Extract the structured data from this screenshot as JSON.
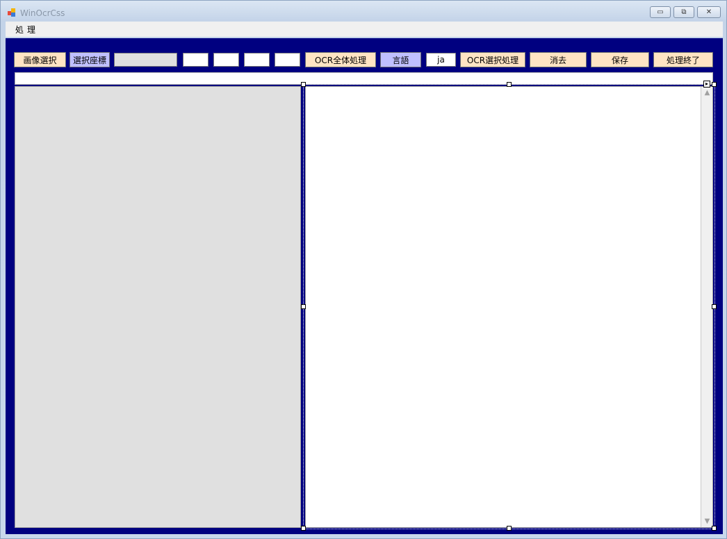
{
  "window": {
    "title": "WinOcrCss",
    "minimize_glyph": "▭",
    "maximize_glyph": "⧉",
    "close_glyph": "✕"
  },
  "menu": {
    "items": [
      {
        "label": "処理"
      }
    ]
  },
  "toolbar": {
    "select_image_label": "画像選択",
    "select_coords_label": "選択座標",
    "coord_display_value": "",
    "x_value": "",
    "y_value": "",
    "w_value": "",
    "h_value": "",
    "ocr_all_label": "OCR全体処理",
    "language_label": "言語",
    "language_value": "ja",
    "ocr_selection_label": "OCR選択処理",
    "clear_label": "消去",
    "save_label": "保存",
    "exit_label": "処理終了"
  },
  "colors": {
    "client_bg": "#000080",
    "peach_button": "#ffe4c4",
    "lavender_button": "#c0c0ff",
    "image_panel_bg": "#e0e0e0"
  },
  "icons": {
    "scroll_up": "▲",
    "scroll_down": "▼",
    "smart_tag": "▸"
  }
}
